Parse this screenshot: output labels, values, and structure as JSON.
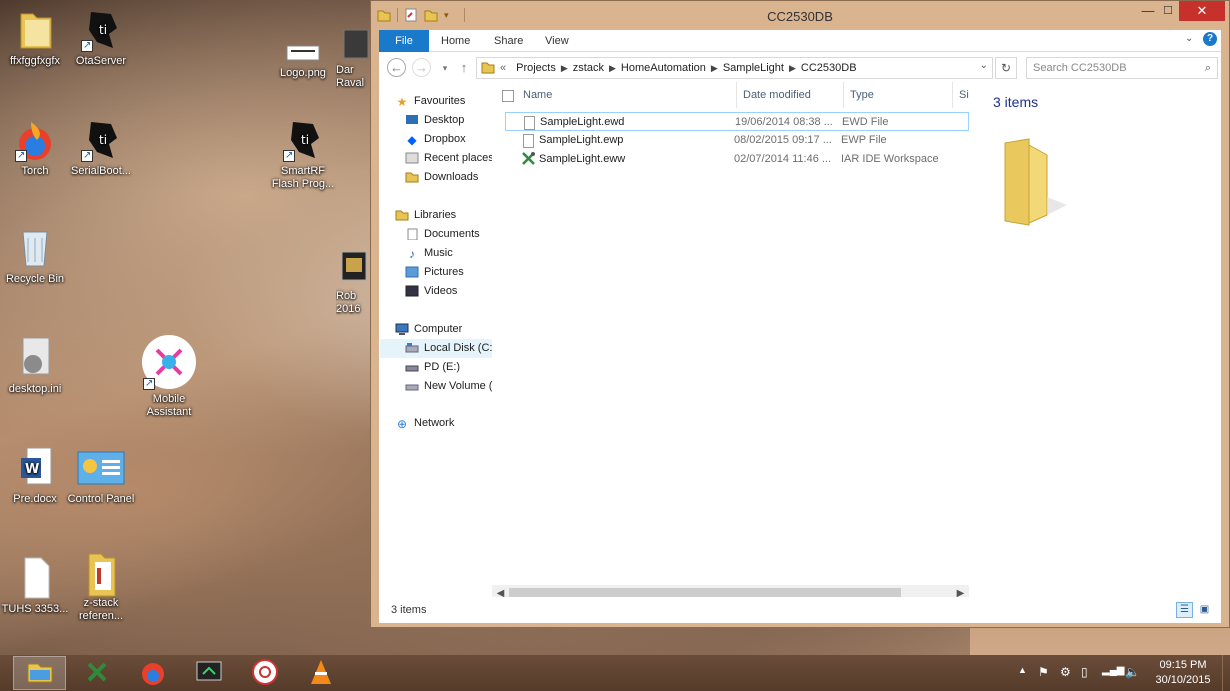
{
  "desktop": {
    "icons": [
      {
        "label": "ffxfggfxgfx"
      },
      {
        "label": "OtaServer"
      },
      {
        "label": "Logo.png"
      },
      {
        "label": "Dar Raval"
      },
      {
        "label": "Torch"
      },
      {
        "label": "SerialBoot..."
      },
      {
        "label": "SmartRF Flash Prog..."
      },
      {
        "label": "Recycle Bin"
      },
      {
        "label": "Rob 2016"
      },
      {
        "label": "desktop.ini"
      },
      {
        "label": "Mobile Assistant"
      },
      {
        "label": "Pre.docx"
      },
      {
        "label": "Control Panel"
      },
      {
        "label": "TUHS 3353..."
      },
      {
        "label": "z-stack referen..."
      }
    ]
  },
  "window": {
    "title": "CC2530DB",
    "controls": {
      "minimize": "—",
      "maximize": "☐",
      "close": "✕"
    },
    "ribbon_tabs": [
      "File",
      "Home",
      "Share",
      "View"
    ],
    "address": {
      "prefix": "«",
      "segments": [
        "Projects",
        "zstack",
        "HomeAutomation",
        "SampleLight",
        "CC2530DB"
      ]
    },
    "search_placeholder": "Search CC2530DB",
    "nav_pane": {
      "favourites": "Favourites",
      "desktop": "Desktop",
      "dropbox": "Dropbox",
      "recent": "Recent places",
      "downloads": "Downloads",
      "libraries": "Libraries",
      "documents": "Documents",
      "music": "Music",
      "pictures": "Pictures",
      "videos": "Videos",
      "computer": "Computer",
      "local_disk": "Local Disk (C:)",
      "pd": "PD (E:)",
      "new_volume": "New Volume (",
      "network": "Network"
    },
    "columns": {
      "name": "Name",
      "date": "Date modified",
      "type": "Type",
      "size": "Siz"
    },
    "files": [
      {
        "name": "SampleLight.ewd",
        "date": "19/06/2014 08:38 ...",
        "type": "EWD File"
      },
      {
        "name": "SampleLight.ewp",
        "date": "08/02/2015 09:17 ...",
        "type": "EWP File"
      },
      {
        "name": "SampleLight.eww",
        "date": "02/07/2014 11:46 ...",
        "type": "IAR IDE Workspace"
      }
    ],
    "preview_count": "3 items",
    "status": "3 items"
  },
  "taskbar": {
    "time": "09:15 PM",
    "date": "30/10/2015"
  },
  "colors": {
    "accent": "#1979ca",
    "title_bar": "#d9b48f",
    "close": "#c7312b",
    "selection_border": "#99d1ff"
  }
}
